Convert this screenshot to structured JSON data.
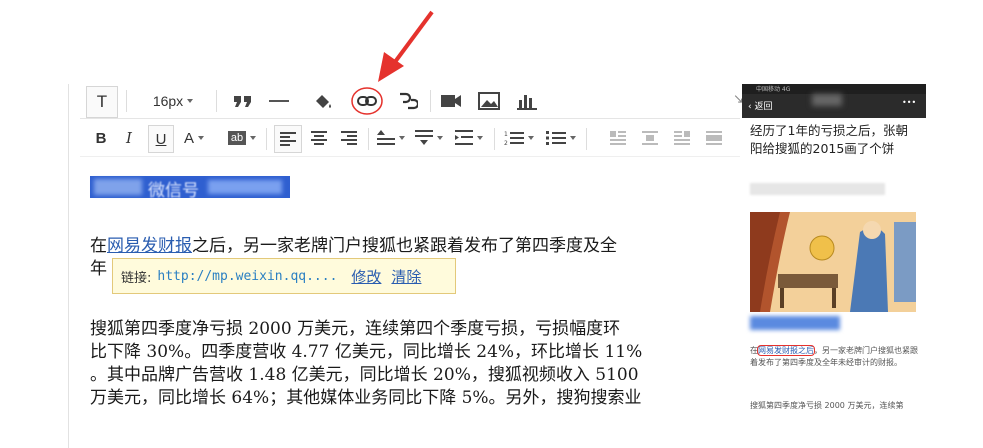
{
  "toolbar": {
    "text_icon": "T",
    "font_size": "16px",
    "icons_row1": [
      "quote-icon",
      "hr-icon",
      "paint-bucket-icon",
      "link-icon",
      "unlink-icon",
      "video-icon",
      "image-icon",
      "chart-icon"
    ],
    "bold": "B",
    "italic": "I",
    "underline": "U",
    "font_color": "A",
    "bg_color": "ab"
  },
  "content": {
    "heading_text": "微信号",
    "para1_prefix": "在",
    "para1_link": "网易发财报",
    "para1_rest": "之后，另一家老牌门户搜狐也紧跟着发布了第四季度及全",
    "para1_line2": "年",
    "para2_lines": [
      "搜狐第四季度净亏损 2000 万美元，连续第四个季度亏损，亏损幅度环",
      "比下降 30%。四季度营收 4.77 亿美元，同比增长 24%，环比增长 11%",
      "。其中品牌广告营收 1.48 亿美元，同比增长 20%，搜狐视频收入 5100",
      "万美元，同比增长 64%；其他媒体业务同比下降 5%。另外，搜狗搜索业"
    ]
  },
  "link_popup": {
    "label": "链接:",
    "url": "http://mp.weixin.qq....",
    "edit": "修改",
    "remove": "清除"
  },
  "phone": {
    "back": "返回",
    "more": "•••",
    "status_carrier": "中国移动  4G",
    "title": "经历了1年的亏损之后，张朝阳给搜狐的2015画了个饼",
    "small_link": "网易发财报之后",
    "small_prefix": "在",
    "small_rest": "，另一家老牌门户搜狐也紧跟着发布了第四季度及全年未经审计的财报。",
    "small_next": "搜狐第四季度净亏损 2000 万美元，连续第"
  },
  "colors": {
    "accent_red": "#e5322d",
    "link_blue": "#2a5db0",
    "popup_bg": "#fffbdc"
  }
}
